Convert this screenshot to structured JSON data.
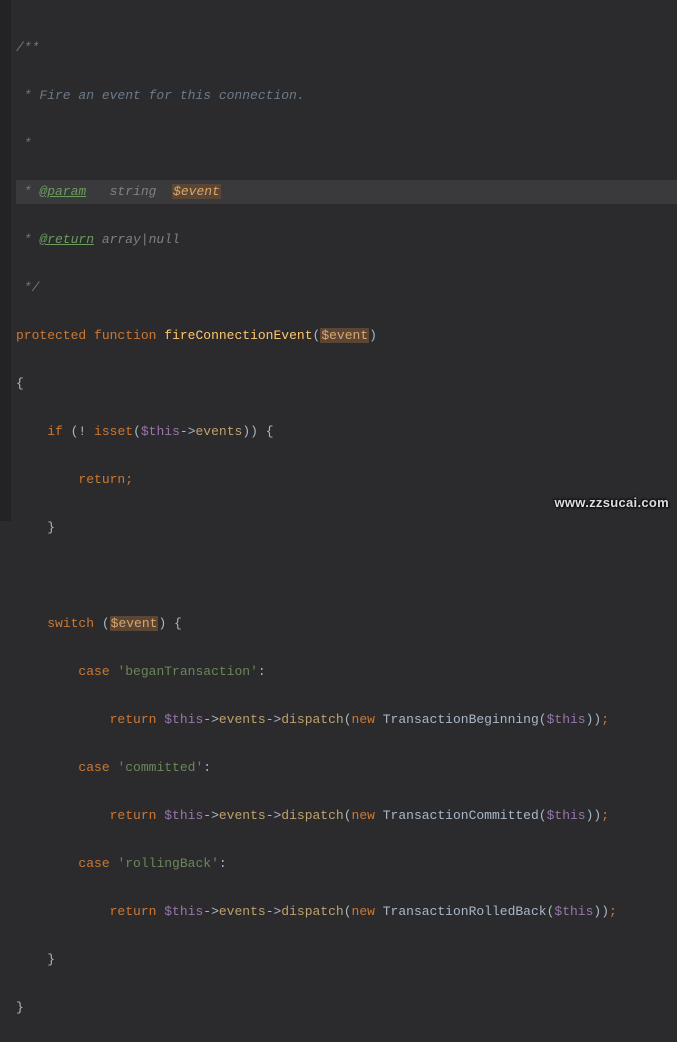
{
  "doc": {
    "open": "/**",
    "desc": " * Fire an event for this connection.",
    "empty": " *",
    "param_star": " * ",
    "param_tag": "@param",
    "param_spaces": "   ",
    "param_type": "string",
    "param_gap": "  ",
    "param_var": "$event",
    "return_star": " * ",
    "return_tag": "@return",
    "return_gap": " ",
    "return_type": "array|null",
    "close": " */"
  },
  "sig": {
    "protected": "protected",
    "function": "function",
    "name": "fireConnectionEvent",
    "open_paren": "(",
    "param": "$event",
    "close_paren": ")"
  },
  "braces": {
    "open": "{",
    "close": "}"
  },
  "ifline": {
    "indent": "    ",
    "if": "if",
    "open": " (! ",
    "isset": "isset",
    "lp": "(",
    "this": "$this",
    "arrow": "->",
    "events": "events",
    "rest": ")) {"
  },
  "ret_plain": {
    "indent": "        ",
    "return": "return",
    "semi": ";"
  },
  "close_inner": {
    "indent": "    ",
    "brace": "}"
  },
  "switchline": {
    "indent": "    ",
    "switch": "switch",
    "open": " (",
    "param": "$event",
    "close": ") {"
  },
  "case1": {
    "indent": "        ",
    "case": "case",
    "sp": " ",
    "str": "'beganTransaction'",
    "colon": ":"
  },
  "case2": {
    "indent": "        ",
    "case": "case",
    "sp": " ",
    "str": "'committed'",
    "colon": ":"
  },
  "case3": {
    "indent": "        ",
    "case": "case",
    "sp": " ",
    "str": "'rollingBack'",
    "colon": ":"
  },
  "disp": {
    "indent": "            ",
    "return": "return",
    "sp": " ",
    "this": "$this",
    "arrow": "->",
    "events": "events",
    "dispatch": "dispatch",
    "lp": "(",
    "new": "new",
    "sp2": " ",
    "cls1": "TransactionBeginning",
    "cls2": "TransactionCommitted",
    "cls3": "TransactionRolledBack",
    "lp2": "(",
    "thisarg": "$this",
    "rp2": ")",
    "rp": ")",
    "semi": ";"
  },
  "watermark": "www.zzsucai.com"
}
